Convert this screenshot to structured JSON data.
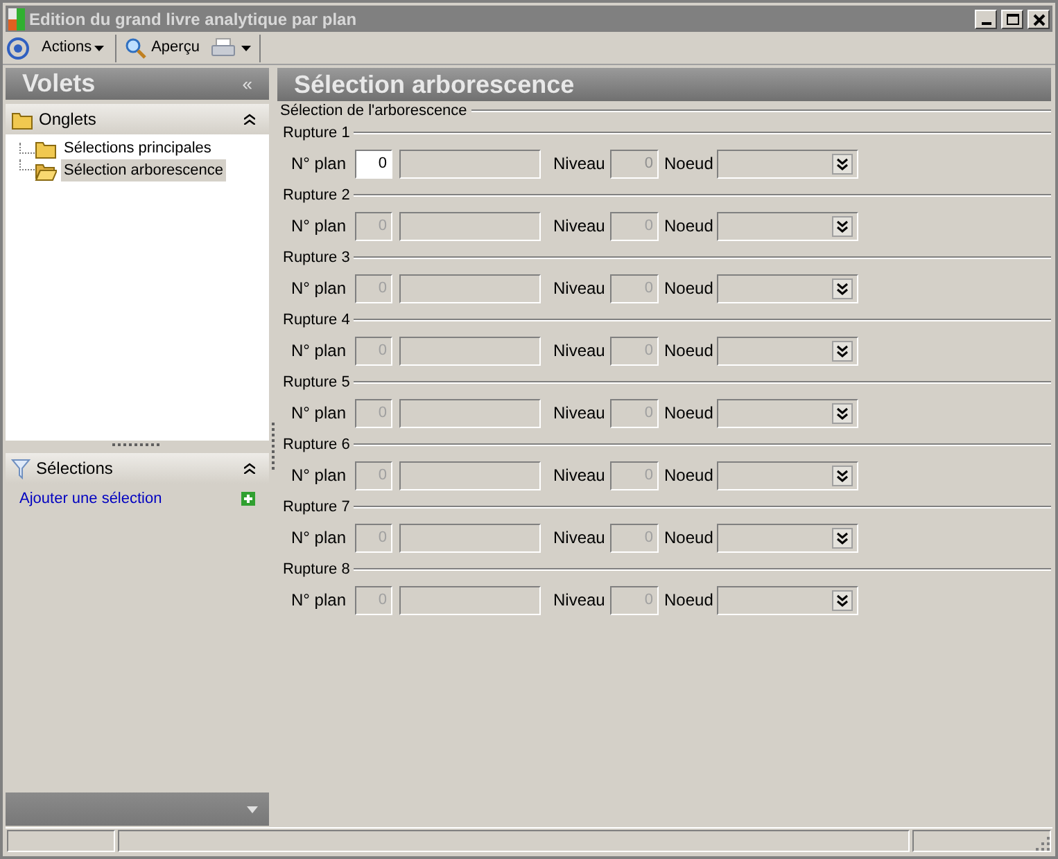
{
  "window": {
    "title": "Edition du grand livre analytique par plan"
  },
  "toolbar": [
    {
      "kind": "menu",
      "label": "Actions"
    },
    {
      "kind": "preview",
      "label": "Aperçu"
    },
    {
      "kind": "print"
    }
  ],
  "sidebar": {
    "title": "Volets",
    "collapse": "«",
    "tabs_section": {
      "title": "Onglets",
      "items": [
        {
          "label": "Sélections principales",
          "selected": false
        },
        {
          "label": "Sélection arborescence",
          "selected": true
        }
      ]
    },
    "selections_section": {
      "title": "Sélections",
      "link": "Ajouter une sélection"
    }
  },
  "content": {
    "title": "Sélection arborescence",
    "group_title": "Sélection de l'arborescence",
    "ruptures": [
      {
        "label": "Rupture 1",
        "plan_label": "N° plan",
        "plan_value": "0",
        "level_label": "Niveau",
        "level_value": "0",
        "node_label": "Noeud",
        "disabled": false
      },
      {
        "label": "Rupture 2",
        "plan_label": "N° plan",
        "plan_value": "0",
        "level_label": "Niveau",
        "level_value": "0",
        "node_label": "Noeud",
        "disabled": true
      },
      {
        "label": "Rupture 3",
        "plan_label": "N° plan",
        "plan_value": "0",
        "level_label": "Niveau",
        "level_value": "0",
        "node_label": "Noeud",
        "disabled": true
      },
      {
        "label": "Rupture 4",
        "plan_label": "N° plan",
        "plan_value": "0",
        "level_label": "Niveau",
        "level_value": "0",
        "node_label": "Noeud",
        "disabled": true
      },
      {
        "label": "Rupture 5",
        "plan_label": "N° plan",
        "plan_value": "0",
        "level_label": "Niveau",
        "level_value": "0",
        "node_label": "Noeud",
        "disabled": true
      },
      {
        "label": "Rupture 6",
        "plan_label": "N° plan",
        "plan_value": "0",
        "level_label": "Niveau",
        "level_value": "0",
        "node_label": "Noeud",
        "disabled": true
      },
      {
        "label": "Rupture 7",
        "plan_label": "N° plan",
        "plan_value": "0",
        "level_label": "Niveau",
        "level_value": "0",
        "node_label": "Noeud",
        "disabled": true
      },
      {
        "label": "Rupture 8",
        "plan_label": "N° plan",
        "plan_value": "0",
        "level_label": "Niveau",
        "level_value": "0",
        "node_label": "Noeud",
        "disabled": true
      }
    ]
  }
}
